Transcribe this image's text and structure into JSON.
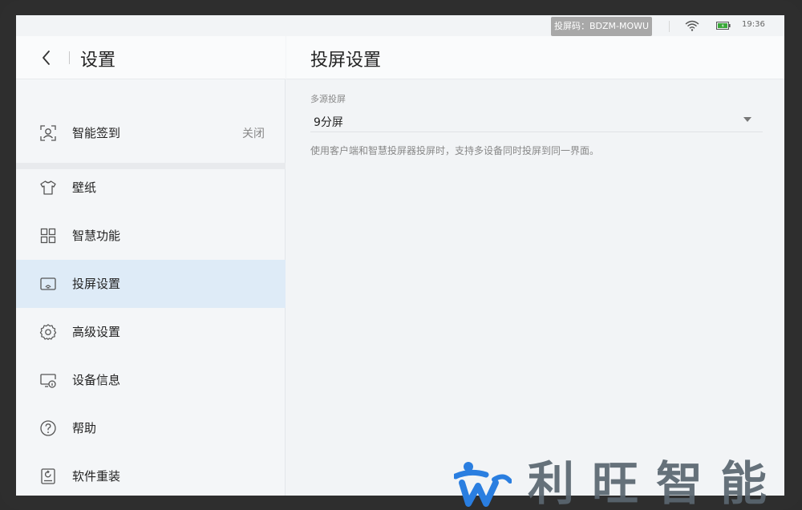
{
  "status_bar": {
    "cast_code": "投屏码：BDZM-MOWU",
    "time": "19:36"
  },
  "sidebar": {
    "title": "设置",
    "items": [
      {
        "label": "智能签到",
        "value": "关闭",
        "icon": "face-scan-icon"
      },
      {
        "label": "壁纸",
        "icon": "shirt-icon"
      },
      {
        "label": "智慧功能",
        "icon": "grid-icon"
      },
      {
        "label": "投屏设置",
        "icon": "screen-cast-icon",
        "active": true
      },
      {
        "label": "高级设置",
        "icon": "gear-icon"
      },
      {
        "label": "设备信息",
        "icon": "device-info-icon"
      },
      {
        "label": "帮助",
        "icon": "help-icon"
      },
      {
        "label": "软件重装",
        "icon": "reinstall-icon"
      }
    ]
  },
  "main": {
    "title": "投屏设置",
    "section_label": "多源投屏",
    "select_value": "9分屏",
    "description": "使用客户端和智慧投屏器投屏时，支持多设备同时投屏到同一界面。"
  },
  "watermark": {
    "text": "利旺智能"
  },
  "colors": {
    "active_bg": "#deebf7",
    "bezel": "#2e2e2e",
    "logo_blue": "#2a7ee0"
  }
}
